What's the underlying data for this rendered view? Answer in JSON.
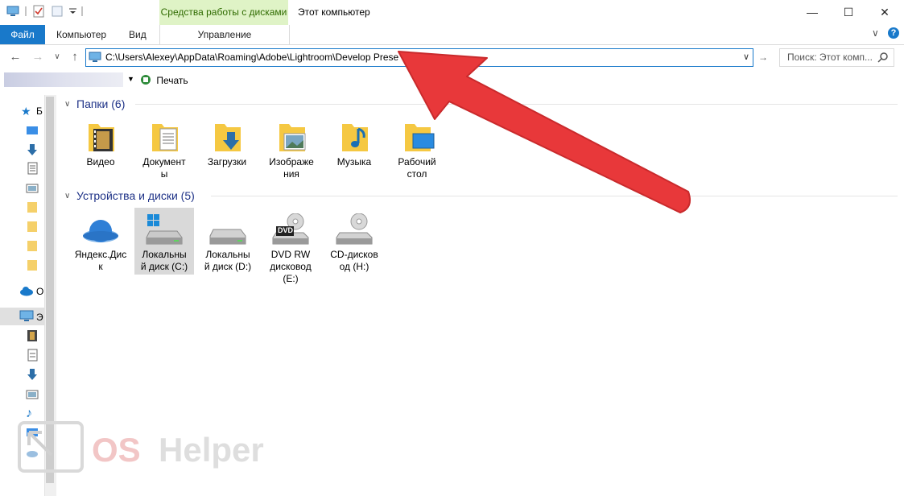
{
  "window": {
    "title": "Этот компьютер",
    "context_tab": "Средства работы с дисками",
    "minimize": "—",
    "maximize": "☐",
    "close": "✕"
  },
  "ribbon": {
    "file": "Файл",
    "tabs": [
      "Компьютер",
      "Вид"
    ],
    "manage": "Управление"
  },
  "address": {
    "path": "C:\\Users\\Alexey\\AppData\\Roaming\\Adobe\\Lightroom\\Develop Prese",
    "dropdown": "∨"
  },
  "search": {
    "placeholder": "Поиск: Этот комп..."
  },
  "toolbar": {
    "print": "Печать"
  },
  "nav": {
    "labels": [
      "Б",
      "О",
      "Э"
    ]
  },
  "groups": {
    "folders_title": "Папки (6)",
    "devices_title": "Устройства и диски (5)"
  },
  "folders": [
    {
      "label": "Видео",
      "icon": "film-icon"
    },
    {
      "label": "Документ\nы",
      "icon": "document-icon"
    },
    {
      "label": "Загрузки",
      "icon": "download-arrow-icon"
    },
    {
      "label": "Изображе\nния",
      "icon": "picture-icon"
    },
    {
      "label": "Музыка",
      "icon": "music-note-icon"
    },
    {
      "label": "Рабочий\nстол",
      "icon": "desktop-icon"
    }
  ],
  "devices": [
    {
      "label": "Яндекс.Дис\nк",
      "icon": "yandex-disk-icon"
    },
    {
      "label": "Локальны\nй диск (C:)",
      "icon": "windows-drive-icon"
    },
    {
      "label": "Локальны\nй диск (D:)",
      "icon": "drive-icon"
    },
    {
      "label": "DVD RW\nдисковод\n(E:)",
      "icon": "dvd-drive-icon",
      "badge": "DVD"
    },
    {
      "label": "CD-дисков\nод (H:)",
      "icon": "cd-drive-icon"
    }
  ],
  "watermark": {
    "text": "OS Helper"
  },
  "colors": {
    "accent": "#1979ca",
    "context_tab_bg": "#dff3c6",
    "group_header": "#1e3287",
    "arrow": "#e8383a",
    "folder": "#f5c842"
  }
}
